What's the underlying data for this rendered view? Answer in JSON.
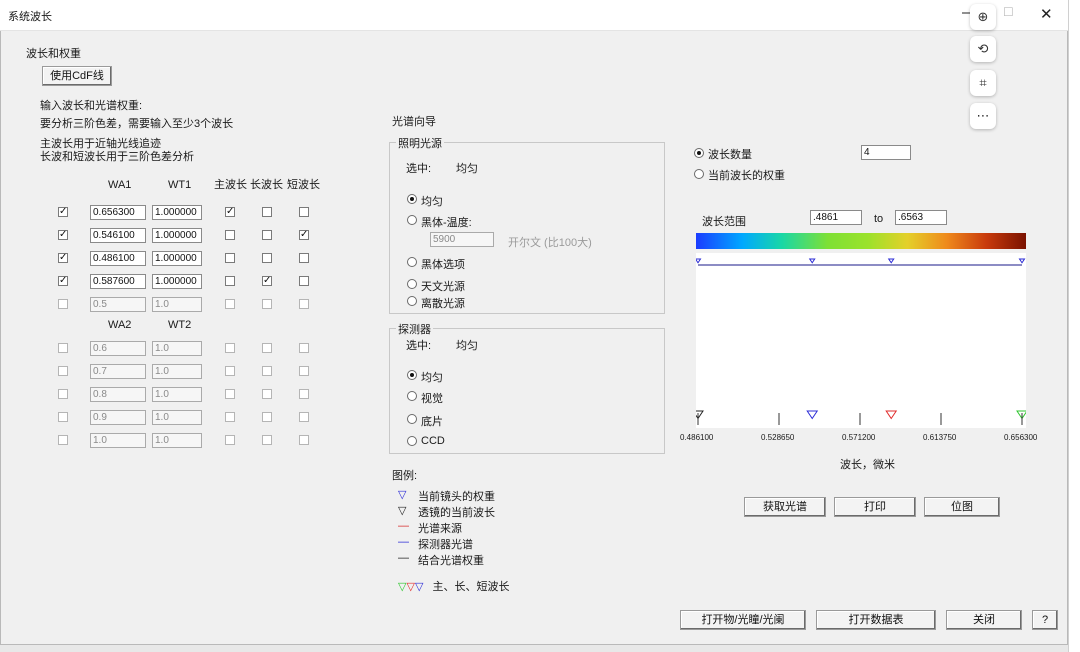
{
  "window": {
    "title": "系统波长"
  },
  "section_title": "波长和权重",
  "use_cdf_button": "使用CdF线",
  "instructions": [
    "输入波长和光谱权重:",
    "要分析三阶色差，需要输入至少3个波长",
    "主波长用于近轴光线追迹",
    "长波和短波长用于三阶色差分析"
  ],
  "table1": {
    "headers": {
      "wa": "WA1",
      "wt": "WT1",
      "primary": "主波长",
      "long": "长波长",
      "short": "短波长"
    },
    "rows": [
      {
        "use": true,
        "wa": "0.656300",
        "wt": "1.000000",
        "primary": true,
        "long": false,
        "short": false,
        "enabled": true
      },
      {
        "use": true,
        "wa": "0.546100",
        "wt": "1.000000",
        "primary": false,
        "long": false,
        "short": true,
        "enabled": true
      },
      {
        "use": true,
        "wa": "0.486100",
        "wt": "1.000000",
        "primary": false,
        "long": false,
        "short": false,
        "enabled": true
      },
      {
        "use": true,
        "wa": "0.587600",
        "wt": "1.000000",
        "primary": false,
        "long": true,
        "short": false,
        "enabled": true
      },
      {
        "use": false,
        "wa": "0.5",
        "wt": "1.0",
        "primary": false,
        "long": false,
        "short": false,
        "enabled": false
      }
    ]
  },
  "table2": {
    "headers": {
      "wa": "WA2",
      "wt": "WT2"
    },
    "rows": [
      {
        "wa": "0.6",
        "wt": "1.0"
      },
      {
        "wa": "0.7",
        "wt": "1.0"
      },
      {
        "wa": "0.8",
        "wt": "1.0"
      },
      {
        "wa": "0.9",
        "wt": "1.0"
      },
      {
        "wa": "1.0",
        "wt": "1.0"
      }
    ]
  },
  "spectrum_guide": "光谱向导",
  "illumination": {
    "label": "照明光源",
    "selected_prefix": "选中:",
    "selected_value": "均匀",
    "options": [
      "均匀",
      "黑体-温度:",
      "黑体选项",
      "天文光源",
      "离散光源"
    ],
    "selected_index": 0,
    "temperature": "5900",
    "temperature_unit": "开尔文 (比100大)"
  },
  "detector": {
    "label": "探测器",
    "selected_prefix": "选中:",
    "selected_value": "均匀",
    "options": [
      "均匀",
      "视觉",
      "底片",
      "CCD"
    ],
    "selected_index": 0
  },
  "legend": {
    "title": "图例:",
    "items": [
      {
        "label": "当前镜头的权重",
        "symbol": "▽",
        "color": "#2b2bd6"
      },
      {
        "label": "透镜的当前波长",
        "symbol": "▽",
        "color": "#222222"
      },
      {
        "label": "光谱来源",
        "symbol": "—",
        "color": "#d62b2b"
      },
      {
        "label": "探测器光谱",
        "symbol": "—",
        "color": "#2b2bd6"
      },
      {
        "label": "结合光谱权重",
        "symbol": "—",
        "color": "#222222"
      }
    ],
    "triangle_label": "主、长、短波长",
    "triangle_colors": [
      "#2ec62e",
      "#e02b2b",
      "#2b2bd6"
    ]
  },
  "mode": {
    "options": [
      "波长数量",
      "当前波长的权重"
    ],
    "selected_index": 0,
    "count": "4"
  },
  "range": {
    "label": "波长范围",
    "from": ".4861",
    "to_label": "to",
    "to": ".6563"
  },
  "plot": {
    "ticks": [
      "0.486100",
      "0.528650",
      "0.571200",
      "0.613750",
      "0.656300"
    ],
    "xlabel": "波长，微米"
  },
  "chart_data": {
    "type": "scatter",
    "xlabel": "波长，微米",
    "xlim": [
      0.4861,
      0.6563
    ],
    "x_ticks": [
      0.4861,
      0.52865,
      0.5712,
      0.61375,
      0.6563
    ],
    "series": [
      {
        "marker": "lens-wavelength",
        "x": [
          0.4861
        ],
        "color": "#222222"
      },
      {
        "marker": "short",
        "x": [
          0.5461
        ],
        "color": "#2b2bd6"
      },
      {
        "marker": "long",
        "x": [
          0.5876
        ],
        "color": "#e02b2b"
      },
      {
        "marker": "primary",
        "x": [
          0.6563
        ],
        "color": "#2ec62e"
      },
      {
        "marker": "lens-weight",
        "x": [
          0.4861,
          0.5461,
          0.5876,
          0.6563
        ],
        "color": "#2b2bd6"
      }
    ]
  },
  "buttons": {
    "get_spectrum": "获取光谱",
    "print": "打印",
    "bitmap": "位图",
    "open_aperture": "打开物/光瞳/光阑",
    "open_table": "打开数据表",
    "close": "关闭",
    "help": "?"
  },
  "colors": {
    "accent": "#2b2bd6",
    "dialog_bg": "#f0f0f0"
  }
}
